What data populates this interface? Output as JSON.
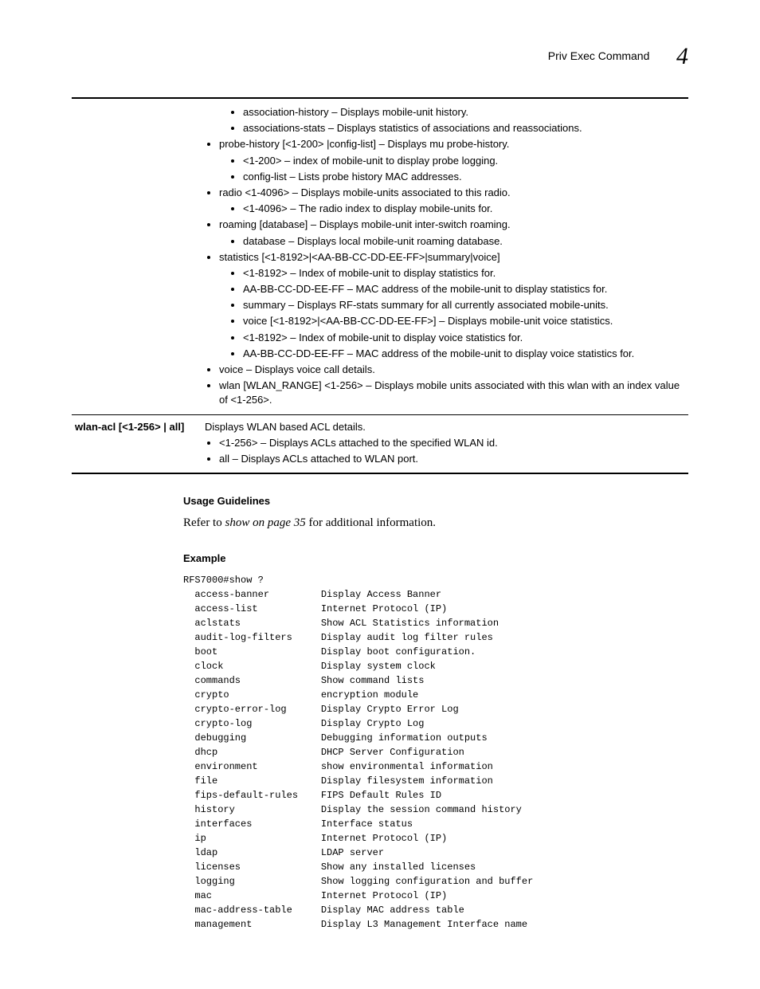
{
  "header": {
    "title": "Priv Exec Command",
    "chapter": "4"
  },
  "table": {
    "row1": {
      "b1_1": "association-history – Displays mobile-unit history.",
      "b1_2": "associations-stats – Displays statistics of associations and reassociations.",
      "b2": "probe-history [<1-200> |config-list] – Displays mu probe-history.",
      "b2_1": "<1-200> – index of mobile-unit to display probe logging.",
      "b2_2": "config-list – Lists probe history MAC addresses.",
      "b3": "radio <1-4096> – Displays mobile-units associated to this radio.",
      "b3_1": "<1-4096> – The radio index to display mobile-units for.",
      "b4": "roaming [database] – Displays mobile-unit inter-switch roaming.",
      "b4_1": "database – Displays local mobile-unit roaming database.",
      "b5": "statistics [<1-8192>|<AA-BB-CC-DD-EE-FF>|summary|voice]",
      "b5_1": "<1-8192> – Index of mobile-unit to display statistics for.",
      "b5_2": "AA-BB-CC-DD-EE-FF – MAC address of the mobile-unit to display statistics for.",
      "b5_3": "summary – Displays RF-stats summary for all currently associated mobile-units.",
      "b5_4": "voice [<1-8192>|<AA-BB-CC-DD-EE-FF>] – Displays mobile-unit voice statistics.",
      "b5_5": "<1-8192> – Index of mobile-unit to display voice statistics for.",
      "b5_6": "AA-BB-CC-DD-EE-FF – MAC address of the mobile-unit to display voice statistics for.",
      "b6": "voice – Displays voice call details.",
      "b7": "wlan [WLAN_RANGE] <1-256> – Displays mobile units associated with this wlan with an index value of <1-256>."
    },
    "row2": {
      "param": "wlan-acl [<1-256> | all]",
      "desc": "Displays WLAN based ACL details.",
      "b1": "<1-256> – Displays ACLs attached to the specified WLAN id.",
      "b2": "all – Displays ACLs attached to WLAN port."
    }
  },
  "sections": {
    "usage": "Usage Guidelines",
    "usage_text_pre": "Refer to ",
    "usage_text_em": "show on page 35",
    "usage_text_post": " for additional information.",
    "example": "Example"
  },
  "example_code": "RFS7000#show ?\n  access-banner         Display Access Banner\n  access-list           Internet Protocol (IP)\n  aclstats              Show ACL Statistics information\n  audit-log-filters     Display audit log filter rules\n  boot                  Display boot configuration.\n  clock                 Display system clock\n  commands              Show command lists\n  crypto                encryption module\n  crypto-error-log      Display Crypto Error Log\n  crypto-log            Display Crypto Log\n  debugging             Debugging information outputs\n  dhcp                  DHCP Server Configuration\n  environment           show environmental information\n  file                  Display filesystem information\n  fips-default-rules    FIPS Default Rules ID\n  history               Display the session command history\n  interfaces            Interface status\n  ip                    Internet Protocol (IP)\n  ldap                  LDAP server\n  licenses              Show any installed licenses\n  logging               Show logging configuration and buffer\n  mac                   Internet Protocol (IP)\n  mac-address-table     Display MAC address table\n  management            Display L3 Management Interface name"
}
